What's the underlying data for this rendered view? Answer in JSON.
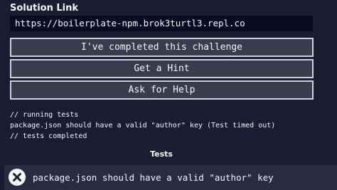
{
  "solution": {
    "label": "Solution Link",
    "value": "https://boilerplate-npm.brok3turtl3.repl.co"
  },
  "buttons": {
    "completed": "I've completed this challenge",
    "hint": "Get a Hint",
    "help": "Ask for Help"
  },
  "console": {
    "lines": [
      "// running tests",
      "package.json should have a valid \"author\" key (Test timed out)",
      "// tests completed"
    ]
  },
  "tests": {
    "heading": "Tests",
    "items": [
      {
        "status": "fail",
        "icon": "fail-x-icon",
        "text": "package.json should have a valid \"author\" key"
      }
    ]
  },
  "colors": {
    "background": "#1b1b32",
    "input_background": "#0a0a23",
    "button_background": "#3b3b4f",
    "button_border": "#d0d0d5",
    "test_row_background": "#2a2a40",
    "text": "#f5f6f7"
  }
}
